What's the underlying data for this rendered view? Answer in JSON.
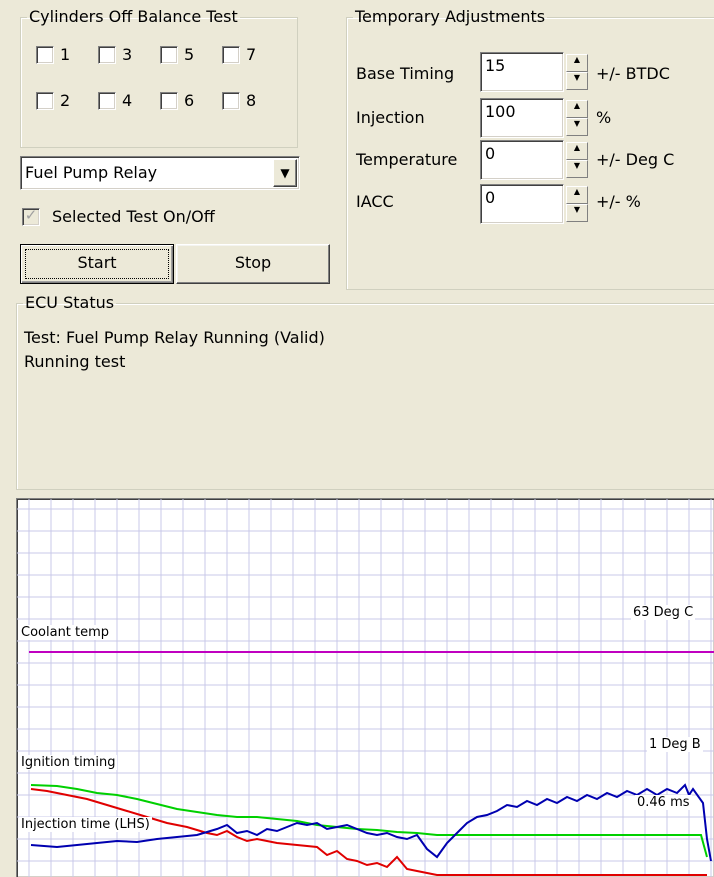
{
  "cylinders_group": {
    "title": "Cylinders Off Balance Test",
    "cylinders": [
      "1",
      "3",
      "5",
      "7",
      "2",
      "4",
      "6",
      "8"
    ]
  },
  "test_select": {
    "selected": "Fuel Pump Relay"
  },
  "selected_test_toggle": {
    "label": "Selected Test On/Off",
    "checked": true
  },
  "buttons": {
    "start": "Start",
    "stop": "Stop"
  },
  "temp_adjust": {
    "title": "Temporary Adjustments",
    "rows": [
      {
        "label": "Base Timing",
        "value": "15",
        "unit": "+/- BTDC"
      },
      {
        "label": "Injection",
        "value": "100",
        "unit": "%"
      },
      {
        "label": "Temperature",
        "value": "0",
        "unit": "+/- Deg C"
      },
      {
        "label": "IACC",
        "value": "0",
        "unit": "+/- %"
      }
    ]
  },
  "ecu_status": {
    "title": "ECU Status",
    "line1": "Test: Fuel Pump Relay Running (Valid)",
    "line2": "Running test"
  },
  "chart_data": {
    "type": "line",
    "series": [
      {
        "name": "Coolant temp",
        "color": "#c000c0",
        "current_value_label": "63 Deg C"
      },
      {
        "name": "Ignition timing",
        "color": "#00c000",
        "current_value_label": "1 Deg B"
      },
      {
        "name": "Injection time (LHS)",
        "color": "#0000c0",
        "current_value_label": "0.46 ms"
      },
      {
        "name": "",
        "color": "#e00000"
      }
    ],
    "grid": true
  }
}
